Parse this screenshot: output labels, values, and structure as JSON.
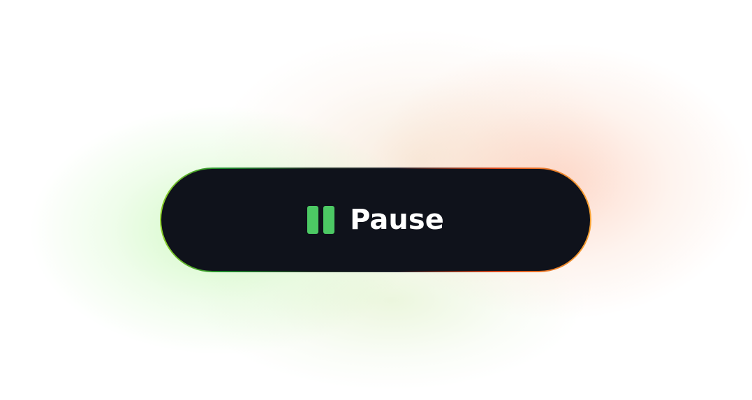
{
  "button": {
    "label": "Pause",
    "icon": "pause-icon"
  },
  "colors": {
    "button_background": "#0f121b",
    "icon": "#4cc964",
    "label": "#ffffff",
    "border_left": "#8fd12b",
    "border_right": "#f7a233",
    "glow_left": "#96f078",
    "glow_right": "#fa966e"
  }
}
